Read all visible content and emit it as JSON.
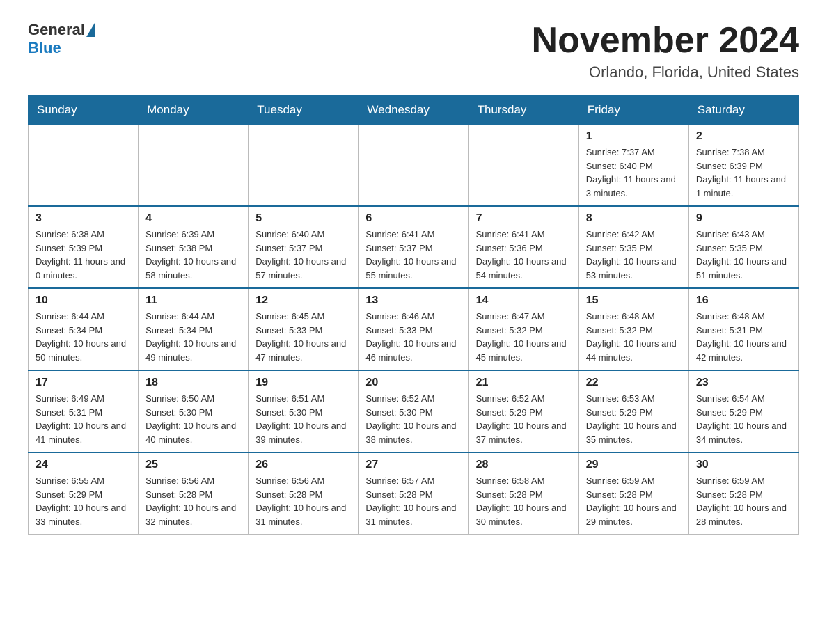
{
  "header": {
    "logo_text_general": "General",
    "logo_text_blue": "Blue",
    "month_title": "November 2024",
    "location": "Orlando, Florida, United States"
  },
  "calendar": {
    "days_of_week": [
      "Sunday",
      "Monday",
      "Tuesday",
      "Wednesday",
      "Thursday",
      "Friday",
      "Saturday"
    ],
    "weeks": [
      [
        {
          "day": "",
          "info": ""
        },
        {
          "day": "",
          "info": ""
        },
        {
          "day": "",
          "info": ""
        },
        {
          "day": "",
          "info": ""
        },
        {
          "day": "",
          "info": ""
        },
        {
          "day": "1",
          "info": "Sunrise: 7:37 AM\nSunset: 6:40 PM\nDaylight: 11 hours and 3 minutes."
        },
        {
          "day": "2",
          "info": "Sunrise: 7:38 AM\nSunset: 6:39 PM\nDaylight: 11 hours and 1 minute."
        }
      ],
      [
        {
          "day": "3",
          "info": "Sunrise: 6:38 AM\nSunset: 5:39 PM\nDaylight: 11 hours and 0 minutes."
        },
        {
          "day": "4",
          "info": "Sunrise: 6:39 AM\nSunset: 5:38 PM\nDaylight: 10 hours and 58 minutes."
        },
        {
          "day": "5",
          "info": "Sunrise: 6:40 AM\nSunset: 5:37 PM\nDaylight: 10 hours and 57 minutes."
        },
        {
          "day": "6",
          "info": "Sunrise: 6:41 AM\nSunset: 5:37 PM\nDaylight: 10 hours and 55 minutes."
        },
        {
          "day": "7",
          "info": "Sunrise: 6:41 AM\nSunset: 5:36 PM\nDaylight: 10 hours and 54 minutes."
        },
        {
          "day": "8",
          "info": "Sunrise: 6:42 AM\nSunset: 5:35 PM\nDaylight: 10 hours and 53 minutes."
        },
        {
          "day": "9",
          "info": "Sunrise: 6:43 AM\nSunset: 5:35 PM\nDaylight: 10 hours and 51 minutes."
        }
      ],
      [
        {
          "day": "10",
          "info": "Sunrise: 6:44 AM\nSunset: 5:34 PM\nDaylight: 10 hours and 50 minutes."
        },
        {
          "day": "11",
          "info": "Sunrise: 6:44 AM\nSunset: 5:34 PM\nDaylight: 10 hours and 49 minutes."
        },
        {
          "day": "12",
          "info": "Sunrise: 6:45 AM\nSunset: 5:33 PM\nDaylight: 10 hours and 47 minutes."
        },
        {
          "day": "13",
          "info": "Sunrise: 6:46 AM\nSunset: 5:33 PM\nDaylight: 10 hours and 46 minutes."
        },
        {
          "day": "14",
          "info": "Sunrise: 6:47 AM\nSunset: 5:32 PM\nDaylight: 10 hours and 45 minutes."
        },
        {
          "day": "15",
          "info": "Sunrise: 6:48 AM\nSunset: 5:32 PM\nDaylight: 10 hours and 44 minutes."
        },
        {
          "day": "16",
          "info": "Sunrise: 6:48 AM\nSunset: 5:31 PM\nDaylight: 10 hours and 42 minutes."
        }
      ],
      [
        {
          "day": "17",
          "info": "Sunrise: 6:49 AM\nSunset: 5:31 PM\nDaylight: 10 hours and 41 minutes."
        },
        {
          "day": "18",
          "info": "Sunrise: 6:50 AM\nSunset: 5:30 PM\nDaylight: 10 hours and 40 minutes."
        },
        {
          "day": "19",
          "info": "Sunrise: 6:51 AM\nSunset: 5:30 PM\nDaylight: 10 hours and 39 minutes."
        },
        {
          "day": "20",
          "info": "Sunrise: 6:52 AM\nSunset: 5:30 PM\nDaylight: 10 hours and 38 minutes."
        },
        {
          "day": "21",
          "info": "Sunrise: 6:52 AM\nSunset: 5:29 PM\nDaylight: 10 hours and 37 minutes."
        },
        {
          "day": "22",
          "info": "Sunrise: 6:53 AM\nSunset: 5:29 PM\nDaylight: 10 hours and 35 minutes."
        },
        {
          "day": "23",
          "info": "Sunrise: 6:54 AM\nSunset: 5:29 PM\nDaylight: 10 hours and 34 minutes."
        }
      ],
      [
        {
          "day": "24",
          "info": "Sunrise: 6:55 AM\nSunset: 5:29 PM\nDaylight: 10 hours and 33 minutes."
        },
        {
          "day": "25",
          "info": "Sunrise: 6:56 AM\nSunset: 5:28 PM\nDaylight: 10 hours and 32 minutes."
        },
        {
          "day": "26",
          "info": "Sunrise: 6:56 AM\nSunset: 5:28 PM\nDaylight: 10 hours and 31 minutes."
        },
        {
          "day": "27",
          "info": "Sunrise: 6:57 AM\nSunset: 5:28 PM\nDaylight: 10 hours and 31 minutes."
        },
        {
          "day": "28",
          "info": "Sunrise: 6:58 AM\nSunset: 5:28 PM\nDaylight: 10 hours and 30 minutes."
        },
        {
          "day": "29",
          "info": "Sunrise: 6:59 AM\nSunset: 5:28 PM\nDaylight: 10 hours and 29 minutes."
        },
        {
          "day": "30",
          "info": "Sunrise: 6:59 AM\nSunset: 5:28 PM\nDaylight: 10 hours and 28 minutes."
        }
      ]
    ]
  }
}
